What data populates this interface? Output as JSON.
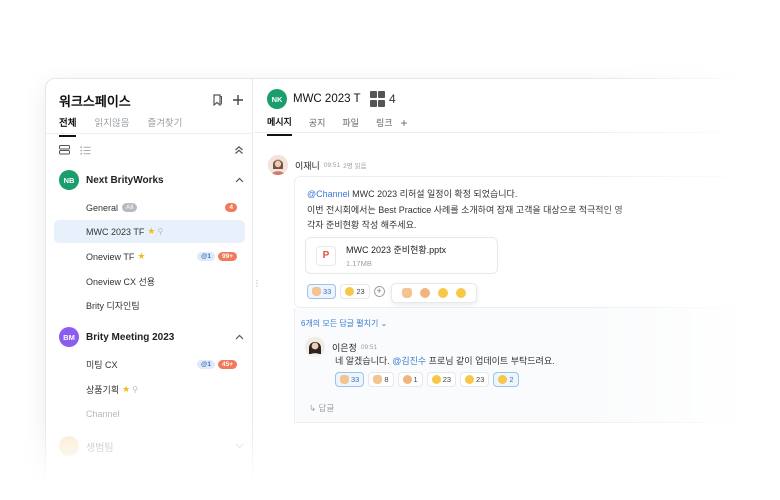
{
  "sidebar": {
    "title": "워크스페이스",
    "tabs": [
      {
        "label": "전체",
        "active": true
      },
      {
        "label": "읽지않음",
        "active": false
      },
      {
        "label": "즐겨찾기",
        "active": false
      }
    ],
    "workspaces": [
      {
        "initials": "NB",
        "name": "Next BrityWorks",
        "color": "#1a9e6c",
        "channels": [
          {
            "name": "General",
            "tag": "All",
            "unread": "4"
          },
          {
            "name": "MWC 2023 TF",
            "starred": true,
            "active": true
          },
          {
            "name": "Oneview TF",
            "starred": true,
            "mention": "@1",
            "unread": "99+"
          },
          {
            "name": "Oneview CX 선용"
          },
          {
            "name": "Brity 디자인팀"
          }
        ]
      },
      {
        "initials": "BM",
        "name": "Brity Meeting 2023",
        "color": "#8a5cf0",
        "channels": [
          {
            "name": "미팅 CX",
            "mention": "@1",
            "unread": "45+"
          },
          {
            "name": "상품기획",
            "starred": true
          },
          {
            "name": "Channel",
            "muted": true
          }
        ]
      },
      {
        "initials": "",
        "name": "생범팀",
        "color": "#f3c77a",
        "faded": true
      }
    ]
  },
  "channel": {
    "initials": "NK",
    "title": "MWC 2023 T",
    "member_count": "4",
    "tabs": [
      {
        "label": "메시지",
        "active": true
      },
      {
        "label": "공지"
      },
      {
        "label": "파일"
      },
      {
        "label": "링크"
      }
    ]
  },
  "message": {
    "author": "이재니",
    "time": "09:51",
    "read_status": "2명 읽음",
    "mention": "@Channel",
    "line1": " MWC 2023 리허설 일정이 확정 되었습니다.",
    "line2": "이번 전시회에서는 Best Practice 사례를 소개하여 잠재 고객을 대상으로 적극적인 영",
    "line3": "각자 준비현황 작성 해주세요.",
    "file": {
      "type_letter": "P",
      "name": "MWC 2023 준비현황.pptx",
      "size": "1.17MB"
    },
    "reactions": [
      {
        "emoji": "thumbs-up",
        "count": "33",
        "selected": true
      },
      {
        "emoji": "smile",
        "count": "23",
        "selected": false
      }
    ],
    "picker": [
      "ok-hand",
      "clap",
      "kiss",
      "grin"
    ]
  },
  "thread": {
    "view_replies": "6개의 모든 답글 펼치기",
    "reply": {
      "author": "이은정",
      "time": "09:51",
      "text_pre": "네 알겠습니다. ",
      "mention": "@김진수",
      "text_post": " 프로님 같이 업데이트 부탁드려요.",
      "reactions": [
        {
          "emoji": "thumbs-up",
          "count": "33",
          "selected": true
        },
        {
          "emoji": "hand",
          "count": "8",
          "selected": false
        },
        {
          "emoji": "clap",
          "count": "1",
          "selected": false
        },
        {
          "emoji": "grin",
          "count": "23",
          "selected": false
        },
        {
          "emoji": "smile",
          "count": "23",
          "selected": false
        },
        {
          "emoji": "smile",
          "count": "2",
          "selected": true
        }
      ]
    },
    "reply_label": "답글"
  }
}
